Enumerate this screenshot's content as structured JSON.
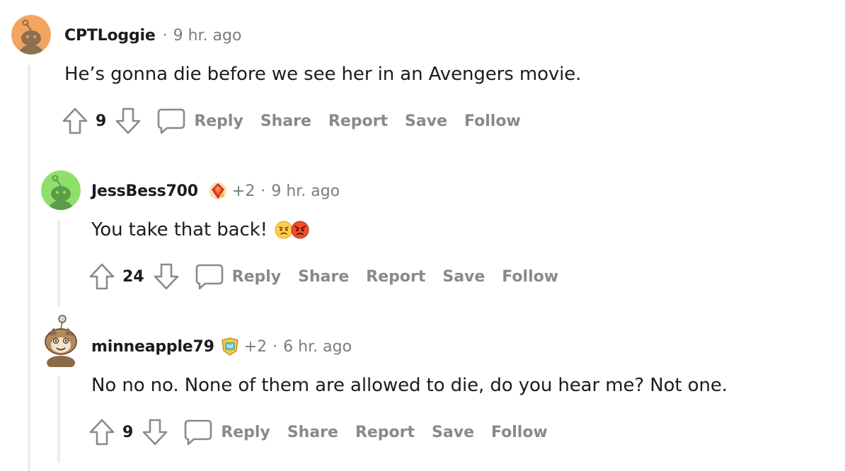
{
  "comments": [
    {
      "username": "CPTLoggie",
      "karma": "",
      "separator": "·",
      "time": "9 hr. ago",
      "text": "He’s gonna die before we see her in an Avengers movie.",
      "votes": "9",
      "actions": {
        "reply": "Reply",
        "share": "Share",
        "report": "Report",
        "save": "Save",
        "follow": "Follow"
      },
      "avatar_color": "#f4a460"
    },
    {
      "username": "JessBess700",
      "karma": "+2",
      "separator": "·",
      "time": "9 hr. ago",
      "text": "You take that back!",
      "emojis": [
        "frowning-face-icon",
        "angry-face-icon"
      ],
      "votes": "24",
      "actions": {
        "reply": "Reply",
        "share": "Share",
        "report": "Report",
        "save": "Save",
        "follow": "Follow"
      },
      "avatar_color": "#8ee06b"
    },
    {
      "username": "minneapple79",
      "karma": "+2",
      "separator": "·",
      "time": "6 hr. ago",
      "text": "No no no. None of them are allowed to die, do you hear me? Not one.",
      "votes": "9",
      "actions": {
        "reply": "Reply",
        "share": "Share",
        "report": "Report",
        "save": "Save",
        "follow": "Follow"
      },
      "avatar_color": "#ffffff"
    }
  ],
  "colors": {
    "text": "#1c1c1c",
    "meta": "#7c7c7c",
    "action": "#878a8c",
    "thread_line": "#ededed"
  }
}
